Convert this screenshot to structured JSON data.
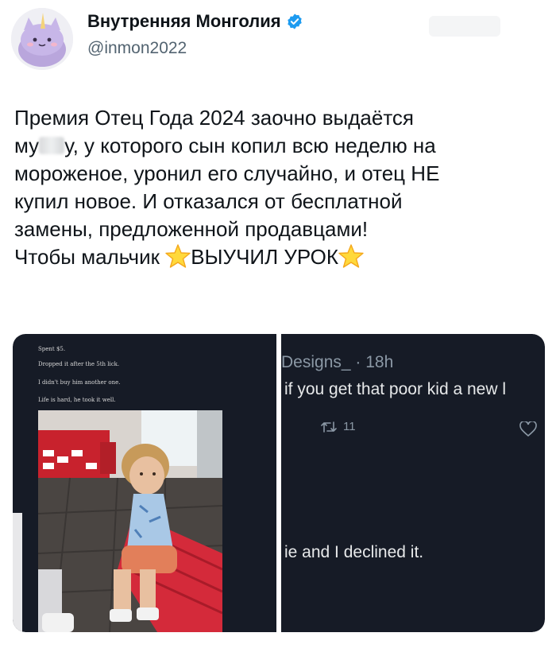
{
  "author": {
    "display_name": "Внутренняя Монголия",
    "handle": "@inmon2022",
    "verified": true,
    "verified_color": "#1d9bf0"
  },
  "tweet": {
    "line1": "Премия Отец Года 2024 заочно выдаётся",
    "line2_start": "му",
    "line2_end": "у, у которого сын копил всю неделю на",
    "line3": "мороженое, уронил его случайно, и отец НЕ",
    "line4": "купил новое. И отказался от бесплатной",
    "line5": "замены, предложенной продавцами!",
    "line6_start": "Чтобы мальчик ",
    "line6_emphasis": "ВЫУЧИЛ УРОК",
    "emoji": "star-emoji"
  },
  "media_left": {
    "captions": [
      "Spent $5.",
      "Dropped it after the 5th lick.",
      "I didn't buy him another one.",
      "Life is hard, he took it well."
    ]
  },
  "media_right": {
    "user": "Designs_ · 18h",
    "reply_text": "if you get that poor kid a new l",
    "retweet_count": "11",
    "reply_text2": "ie and I declined it."
  },
  "colors": {
    "text": "#0f1419",
    "secondary": "#536471",
    "dark_bg": "#161b26"
  }
}
